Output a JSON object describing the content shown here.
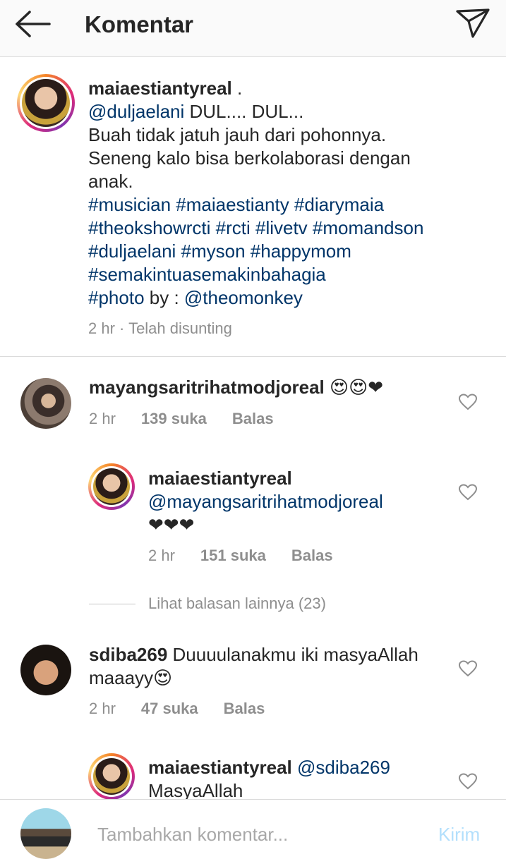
{
  "header": {
    "title": "Komentar",
    "back_icon": "arrow-left-icon",
    "send_icon": "paper-plane-icon"
  },
  "post": {
    "username": "maiaestiantyreal",
    "after_username": " .",
    "lines": [
      {
        "mention": "@duljaelani",
        "text": " DUL.... DUL..."
      },
      {
        "text": "Buah tidak jatuh jauh dari pohonnya."
      },
      {
        "text": "Seneng kalo bisa berkolaborasi dengan"
      },
      {
        "text": "anak."
      }
    ],
    "hashtags_1": "#musician #maiaestianty #diarymaia",
    "hashtags_2": "#theokshowrcti #rcti #livetv #momandson",
    "hashtags_3": "#duljaelani #myson #happymom",
    "hashtags_4": "#semakintuasemakinbahagia",
    "photo_tag": "#photo",
    "photo_by": " by : ",
    "photo_mention": "@theomonkey",
    "time": "2 hr · Telah disunting"
  },
  "comments": [
    {
      "username": "mayangsaritrihatmodjoreal",
      "emoji": "😍😍",
      "heart": "❤",
      "time": "2 hr",
      "likes": "139 suka",
      "reply": "Balas"
    },
    {
      "username": "maiaestiantyreal",
      "mention": "@mayangsaritrihatmodjoreal",
      "hearts": "❤❤❤",
      "time": "2 hr",
      "likes": "151 suka",
      "reply": "Balas"
    },
    {
      "view_more": "Lihat balasan lainnya (23)"
    },
    {
      "username": "sdiba269",
      "text1": " Duuuulanakmu iki masyaAllah",
      "text2": "maaayy",
      "emoji": "😍",
      "time": "2 hr",
      "likes": "47 suka",
      "reply": "Balas"
    },
    {
      "username": "maiaestiantyreal",
      "mention": "@sdiba269",
      "text2": "MasyaAllah"
    }
  ],
  "footer": {
    "placeholder": "Tambahkan komentar...",
    "send": "Kirim"
  },
  "colors": {
    "link": "#003569",
    "meta": "#8e8e8e",
    "send_disabled": "#b2dffc"
  }
}
